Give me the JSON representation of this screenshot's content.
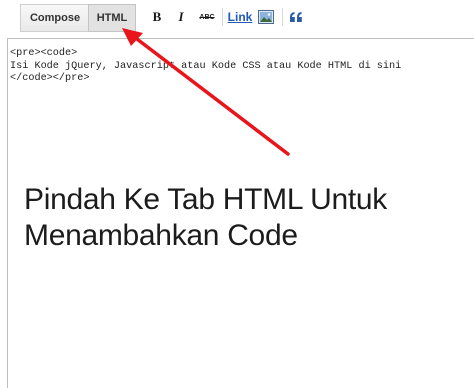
{
  "tabs": [
    {
      "label": "Compose"
    },
    {
      "label": "HTML"
    }
  ],
  "toolbar": {
    "bold_label": "B",
    "italic_label": "I",
    "strike_label": "ABC",
    "link_label": "Link",
    "image_icon": "image-icon",
    "quote_icon": "quote-icon"
  },
  "editor": {
    "lines": [
      "<pre><code>",
      "Isi Kode jQuery, Javascript atau Kode CSS atau Kode HTML di sini",
      "</code></pre>"
    ]
  },
  "annotation": {
    "line1": "Pindah Ke Tab HTML Untuk",
    "line2": "Menambahkan Code",
    "arrow_color": "#e8151b"
  }
}
